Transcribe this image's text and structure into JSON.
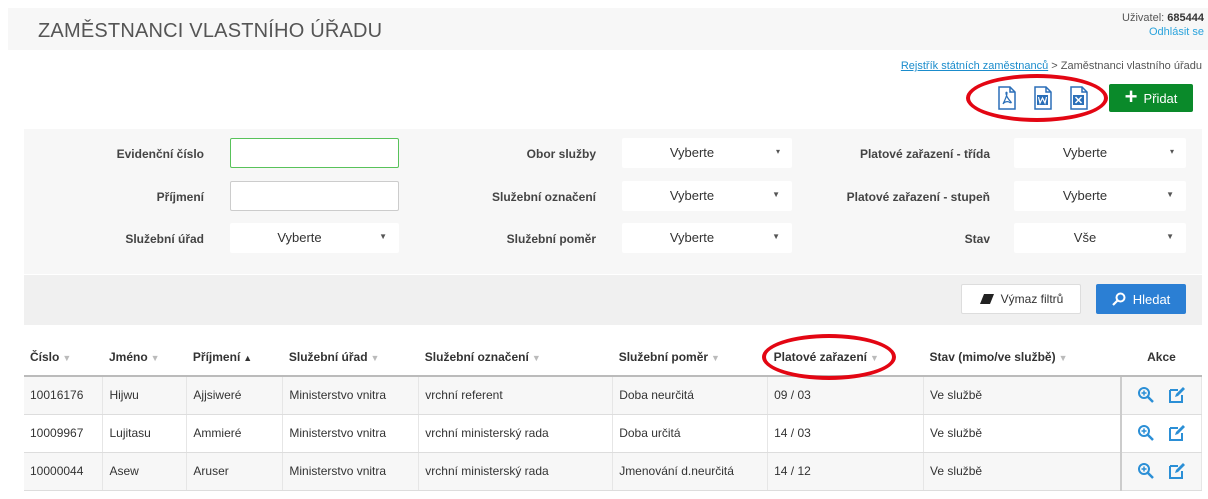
{
  "header": {
    "title": "ZAMĚSTNANCI VLASTNÍHO ÚŘADU",
    "user_label": "Uživatel:",
    "user_id": "685444",
    "logout": "Odhlásit se"
  },
  "breadcrumb": {
    "parent": "Rejstřík státních zaměstnanců",
    "separator": " > ",
    "current": "Zaměstnanci vlastního úřadu"
  },
  "toolbar": {
    "export_icons": [
      "pdf-icon",
      "word-icon",
      "excel-icon"
    ],
    "add_label": "Přidat"
  },
  "filters": {
    "evidencni_cislo": {
      "label": "Evidenční číslo",
      "value": ""
    },
    "prijmeni": {
      "label": "Příjmení",
      "value": ""
    },
    "sluzebni_urad": {
      "label": "Služební úřad",
      "value": "Vyberte"
    },
    "obor_sluzby": {
      "label": "Obor služby",
      "value": "Vyberte"
    },
    "sluzebni_oznaceni": {
      "label": "Služební označení",
      "value": "Vyberte"
    },
    "sluzebni_pomer": {
      "label": "Služební poměr",
      "value": "Vyberte"
    },
    "platove_trida": {
      "label": "Platové zařazení - třída",
      "value": "Vyberte"
    },
    "platove_stupen": {
      "label": "Platové zařazení - stupeň",
      "value": "Vyberte"
    },
    "stav": {
      "label": "Stav",
      "value": "Vše"
    }
  },
  "actions": {
    "clear_label": "Výmaz filtrů",
    "search_label": "Hledat"
  },
  "table": {
    "columns": [
      "Číslo",
      "Jméno",
      "Příjmení",
      "Služební úřad",
      "Služební označení",
      "Služební poměr",
      "Platové zařazení",
      "Stav (mimo/ve službě)",
      "Akce"
    ],
    "rows": [
      [
        "10016176",
        "Hijwu",
        "Ajjsiweré",
        "Ministerstvo vnitra",
        "vrchní referent",
        "Doba neurčitá",
        "09 / 03",
        "Ve službě"
      ],
      [
        "10009967",
        "Lujitasu",
        "Ammieré",
        "Ministerstvo vnitra",
        "vrchní ministerský rada",
        "Doba určitá",
        "14 / 03",
        "Ve službě"
      ],
      [
        "10000044",
        "Asew",
        "Aruser",
        "Ministerstvo vnitra",
        "vrchní ministerský rada",
        "Jmenování d.neurčitá",
        "14 / 12",
        "Ve službě"
      ]
    ]
  },
  "colors": {
    "accent": "#2b7fd4",
    "add": "#0a8a2a",
    "highlight": "#e30613",
    "link": "#1a8ccc"
  }
}
